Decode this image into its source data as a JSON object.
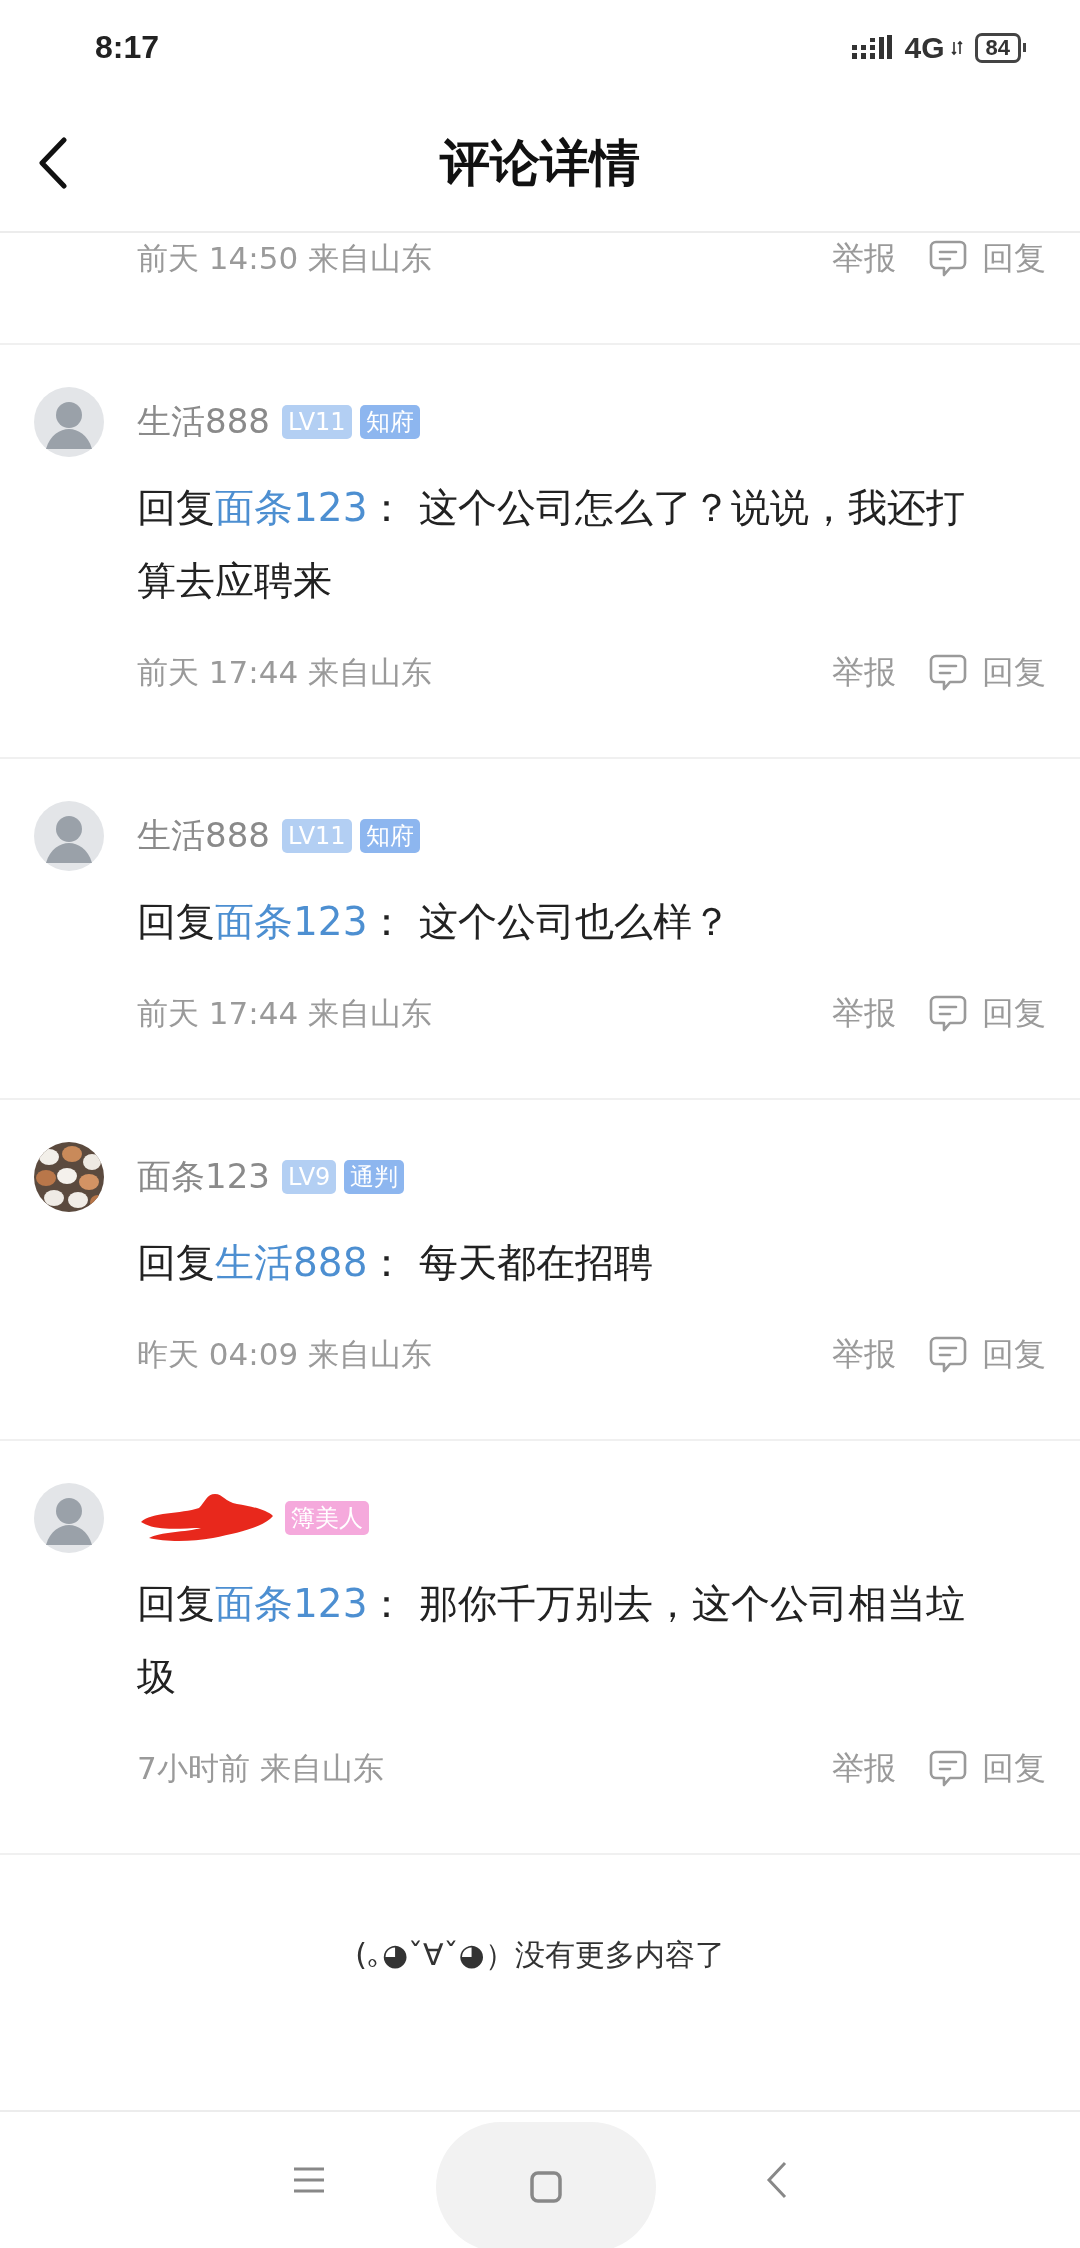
{
  "status_bar": {
    "time": "8:17",
    "network": "4G",
    "battery": "84"
  },
  "header": {
    "title": "评论详情"
  },
  "comments": [
    {
      "kind": "partial",
      "time": "前天 14:50 来自山东",
      "report": "举报",
      "reply": "回复"
    },
    {
      "kind": "full",
      "avatar": {
        "kind": "figure"
      },
      "name": "生活888",
      "name_redacted": false,
      "badges": [
        {
          "text": "LV11",
          "color": "#b3cff3"
        },
        {
          "text": "知府",
          "color": "#8db6ef"
        }
      ],
      "reply_label": "回复",
      "reply_to": "面条123",
      "text": "： 这个公司怎么了？说说，我还打算去应聘来",
      "time": "前天 17:44 来自山东",
      "report": "举报",
      "reply": "回复"
    },
    {
      "kind": "full",
      "avatar": {
        "kind": "figure"
      },
      "name": "生活888",
      "name_redacted": false,
      "badges": [
        {
          "text": "LV11",
          "color": "#b3cff3"
        },
        {
          "text": "知府",
          "color": "#8db6ef"
        }
      ],
      "reply_label": "回复",
      "reply_to": "面条123",
      "text": "： 这个公司也么样？",
      "time": "前天 17:44 来自山东",
      "report": "举报",
      "reply": "回复"
    },
    {
      "kind": "full",
      "name": "面条123",
      "name_redacted": false,
      "badges": [
        {
          "text": "LV9",
          "color": "#b3cff3"
        },
        {
          "text": "通判",
          "color": "#8db6ef"
        }
      ],
      "reply_label": "回复",
      "reply_to": "生活888",
      "text": "： 每天都在招聘",
      "time": "昨天 04:09 来自山东",
      "report": "举报",
      "reply": "回复"
    },
    {
      "kind": "full",
      "avatar": {
        "kind": "figure"
      },
      "name_redacted": true,
      "badges": [
        {
          "text": "簿美人",
          "color": "#f5a9dc"
        }
      ],
      "reply_label": "回复",
      "reply_to": "面条123",
      "text": "： 那你千万别去，这个公司相当垃圾",
      "time": "7小时前 来自山东",
      "report": "举报",
      "reply": "回复"
    }
  ],
  "end_text": "(｡◕ˇ∀ˇ◕）没有更多内容了"
}
